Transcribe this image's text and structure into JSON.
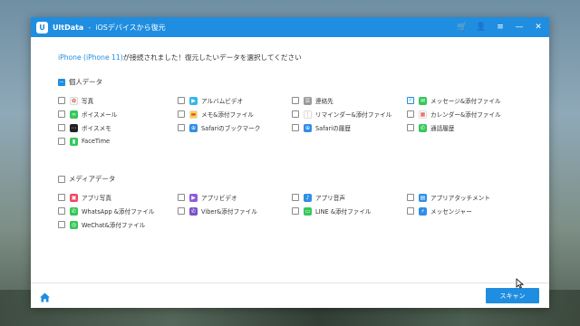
{
  "titlebar": {
    "logo": "U",
    "app_name": "UltData",
    "separator": "-",
    "subtitle": "iOSデバイスから復元",
    "buttons": [
      {
        "name": "cart-icon",
        "glyph": "🛒"
      },
      {
        "name": "user-icon",
        "glyph": "👤"
      },
      {
        "name": "menu-icon",
        "glyph": "≡"
      },
      {
        "name": "minimize-icon",
        "glyph": "—"
      },
      {
        "name": "close-icon",
        "glyph": "✕"
      }
    ]
  },
  "prompt": {
    "device": "iPhone (iPhone 11)",
    "text": "が接続されました！復元したいデータを選択してください"
  },
  "personal": {
    "title": "個人データ",
    "items": [
      {
        "label": "写真",
        "icon": "photos-icon",
        "color": "#f5f5f5",
        "glyph": "✿",
        "checked": false
      },
      {
        "label": "アルバムビデオ",
        "icon": "album-video-icon",
        "color": "#35b7e8",
        "glyph": "▶",
        "checked": false
      },
      {
        "label": "連絡先",
        "icon": "contacts-icon",
        "color": "#9a9a9a",
        "glyph": "☰",
        "checked": false
      },
      {
        "label": "メッセージ&添付ファイル",
        "icon": "messages-icon",
        "color": "#35c759",
        "glyph": "✉",
        "checked": true
      },
      {
        "label": "ボイスメール",
        "icon": "voicemail-icon",
        "color": "#35c759",
        "glyph": "∞",
        "checked": false
      },
      {
        "label": "メモ&添付ファイル",
        "icon": "notes-icon",
        "color": "#ffd23c",
        "glyph": "▬",
        "checked": false
      },
      {
        "label": "リマインダー&添付ファイル",
        "icon": "reminders-icon",
        "color": "#ffffff",
        "glyph": "⋮",
        "checked": false
      },
      {
        "label": "カレンダー&添付ファイル",
        "icon": "calendar-icon",
        "color": "#ffffff",
        "glyph": "▦",
        "checked": false
      },
      {
        "label": "ボイスメモ",
        "icon": "voice-memo-icon",
        "color": "#222222",
        "glyph": "⋯",
        "checked": false
      },
      {
        "label": "Safariのブックマーク",
        "icon": "safari-bookmark-icon",
        "color": "#2f8fe6",
        "glyph": "⊕",
        "checked": false
      },
      {
        "label": "Safariの履歴",
        "icon": "safari-history-icon",
        "color": "#2f8fe6",
        "glyph": "⊕",
        "checked": false
      },
      {
        "label": "通話履歴",
        "icon": "call-history-icon",
        "color": "#35c759",
        "glyph": "✆",
        "checked": false
      },
      {
        "label": "FaceTime",
        "icon": "facetime-icon",
        "color": "#35c759",
        "glyph": "▮",
        "checked": false
      }
    ]
  },
  "media": {
    "title": "メディアデータ",
    "items": [
      {
        "label": "アプリ写真",
        "icon": "app-photo-icon",
        "color": "#f0475f",
        "glyph": "▣",
        "checked": false
      },
      {
        "label": "アプリビデオ",
        "icon": "app-video-icon",
        "color": "#8c5bd9",
        "glyph": "▶",
        "checked": false
      },
      {
        "label": "アプリ音声",
        "icon": "app-audio-icon",
        "color": "#2f8fe6",
        "glyph": "♪",
        "checked": false
      },
      {
        "label": "アプリアタッチメント",
        "icon": "app-attachment-icon",
        "color": "#2f8fe6",
        "glyph": "▤",
        "checked": false
      },
      {
        "label": "WhatsApp &添付ファイル",
        "icon": "whatsapp-icon",
        "color": "#35c759",
        "glyph": "✆",
        "checked": false
      },
      {
        "label": "Viber&添付ファイル",
        "icon": "viber-icon",
        "color": "#7b51c9",
        "glyph": "✆",
        "checked": false
      },
      {
        "label": "LINE &添付ファイル",
        "icon": "line-icon",
        "color": "#35c759",
        "glyph": "▭",
        "checked": false
      },
      {
        "label": "メッセンジャー",
        "icon": "messenger-icon",
        "color": "#2f8fe6",
        "glyph": "⚡",
        "checked": false
      },
      {
        "label": "WeChat&添付ファイル",
        "icon": "wechat-icon",
        "color": "#35c759",
        "glyph": "◎",
        "checked": false
      }
    ]
  },
  "footer": {
    "scan_label": "スキャン"
  }
}
